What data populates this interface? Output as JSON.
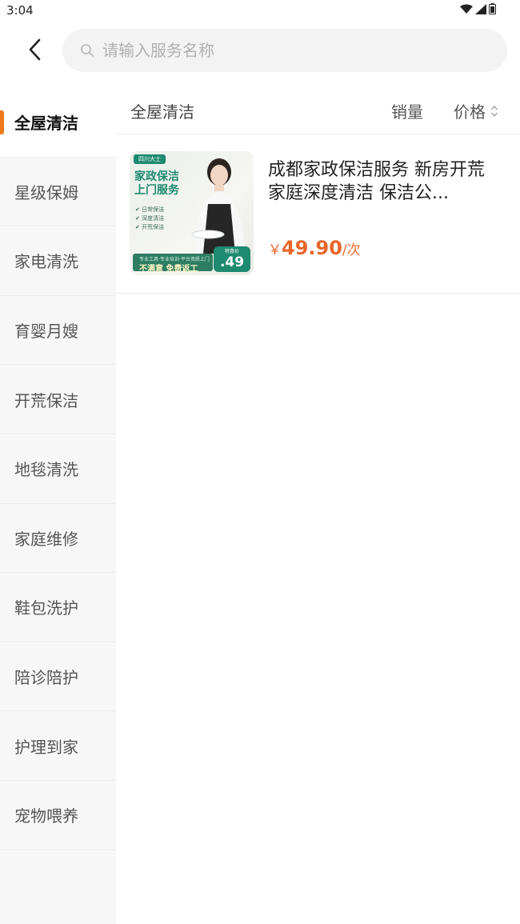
{
  "status_bar": {
    "time": "3:04"
  },
  "search": {
    "placeholder": "请输入服务名称"
  },
  "sidebar": {
    "items": [
      {
        "label": "全屋清洁",
        "active": true
      },
      {
        "label": "星级保姆"
      },
      {
        "label": "家电清洗"
      },
      {
        "label": "育婴月嫂"
      },
      {
        "label": "开荒保洁"
      },
      {
        "label": "地毯清洗"
      },
      {
        "label": "家庭维修"
      },
      {
        "label": "鞋包洗护"
      },
      {
        "label": "陪诊陪护"
      },
      {
        "label": "护理到家"
      },
      {
        "label": "宠物喂养"
      }
    ]
  },
  "sort_bar": {
    "category_title": "全屋清洁",
    "sales_label": "销量",
    "price_label": "价格"
  },
  "products": [
    {
      "title": "成都家政保洁服务 新房开荒家庭深度清洁 保洁公...",
      "currency": "￥",
      "price": "49.90",
      "unit": "/次",
      "image": {
        "tag": "四川大士",
        "headline_1": "家政保洁",
        "headline_2": "上门服务",
        "checks": [
          "日常保洁",
          "深度清洁",
          "开荒保洁"
        ],
        "banner_top": "专业工具·专业培训·平台资质上门",
        "banner_text": "不满意 免费返工",
        "badge_label": "特惠价",
        "badge_num": ".49"
      }
    }
  ],
  "colors": {
    "accent": "#f07a1a",
    "price": "#e8652a",
    "brand_green": "#1e8a6f"
  },
  "icons": {
    "back": "chevron-left-icon",
    "search": "search-icon",
    "sort": "sort-updown-icon",
    "wifi": "wifi-icon",
    "signal": "signal-icon",
    "battery": "battery-icon"
  }
}
